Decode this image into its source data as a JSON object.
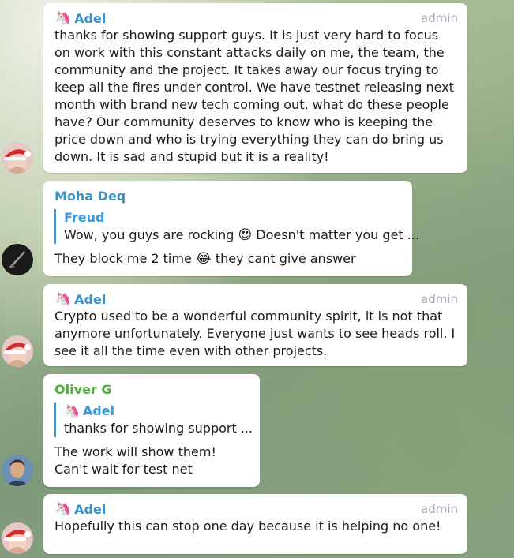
{
  "colors": {
    "adel": "#3a90c8",
    "moha": "#3c93c3",
    "oliver": "#4fae3c",
    "admin": "#a2abb4",
    "reply_bar": "#3a9ad9"
  },
  "messages": [
    {
      "sender": "Adel",
      "badge": "admin",
      "text": "thanks for showing support guys. It is just very hard to focus on work with this constant attacks daily on me, the team, the community and the project. It takes away our focus trying to keep all the fires under control. We have testnet releasing next month with brand new tech coming out, what do these people have? Our community deserves to know who is keeping the price down and who is trying everything they can do bring us down. It is sad and stupid but it is a reality!"
    },
    {
      "sender": "Moha Deq",
      "reply_to": {
        "name": "Freud",
        "text_before": "Wow, you guys are rocking ",
        "emoji": "😍",
        "text_after": " Doesn't matter you get ..."
      },
      "text_before": "They block me 2 time ",
      "emoji": "😂",
      "text_after": " they cant give answer"
    },
    {
      "sender": "Adel",
      "badge": "admin",
      "text": "Crypto used to be a wonderful community spirit, it is not that anymore unfortunately. Everyone just wants to see heads roll. I see it all the time even with other projects."
    },
    {
      "sender": "Oliver G",
      "reply_to": {
        "name": "Adel",
        "text": "thanks for showing support ..."
      },
      "line1": "The work will show them!",
      "line2": "Can't wait for test net"
    },
    {
      "sender": "Adel",
      "badge": "admin",
      "text": "Hopefully this can stop one day because it is helping no one!"
    }
  ]
}
